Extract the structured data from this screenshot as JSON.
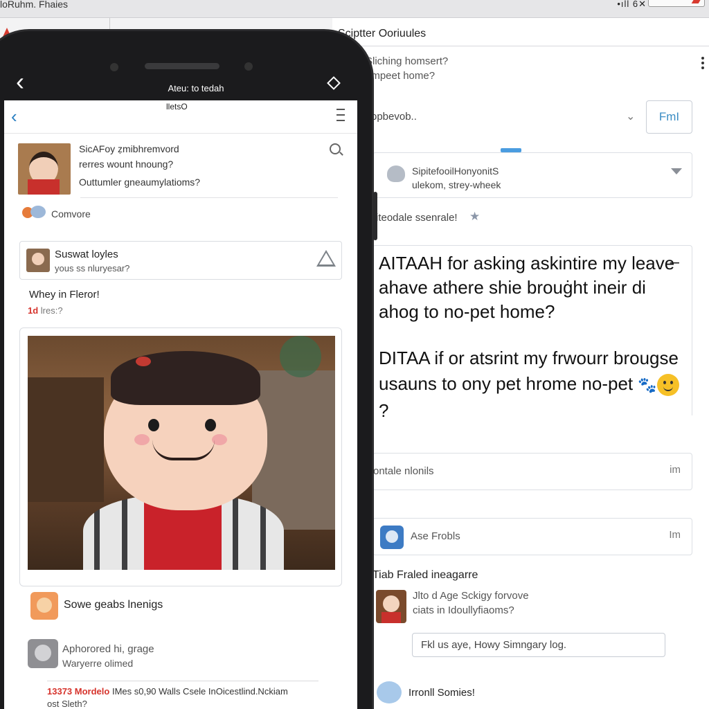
{
  "window": {
    "title": "loRuhm. Fhaies",
    "status": "•ıll 6✕"
  },
  "right_panel": {
    "header": "Sciptter Ooriuules",
    "question_line1": "Sliching homsert?",
    "question_line2": "umpeet home?",
    "filter_label": "opbevob..",
    "filter_button": "FmI",
    "card_title": "SipitefooilHonyonitS",
    "card_subtitle": "ulekom, strey-wheek",
    "suggested_label": "iteodale ssenrale!",
    "post_title": "AITAAH for asking askintire my leave ahave athere shie brouġht ineir di ahog to no-pet home?",
    "post_body_text": "DITAA if or atsrint my frwourr brougse usauns to ony pet hrome no-pet",
    "post_body_end": "?",
    "row1_label": "ontale nlonils",
    "row1_right": "im",
    "row2_label": "Ase Frobls",
    "row2_right": "Im",
    "related_heading": "Tiab Fraled ineagarre",
    "related_line1": "Jlto d Age Sckigy forvove",
    "related_line2": "ciats in Idoullyfiaoms?",
    "reply_value": "Fkl us aye, Howy Simngary log.",
    "bottom_label": "Irronll Somies!"
  },
  "phone": {
    "top_title": "Ateu: to tedah",
    "screen_header": "lletsO",
    "profile_line1": "SicAFoy ẓmibhremvord",
    "profile_line2": "rerres wount hnoung?",
    "profile_line3": "Outtumler gneaumylatioms?",
    "community_label": "Comvore",
    "card_name": "Suswat loyles",
    "card_sub": "yous ss nluryesar?",
    "post_title": "Whey in Fleror!",
    "time_prefix": "1d",
    "time_rest": "lres:?",
    "comment1": "Sowe geabs lnenigs",
    "comment2_line1": "Aphorored hi, grage",
    "comment2_line2": "Waryerre olimed",
    "footer_red": "13373 Mordelo",
    "footer_rest": "IMes s0,90 Walls Csele InOicestlind.Nckiam",
    "footer_line2": "ost Sleth?"
  },
  "colors": {
    "accent_blue": "#2a7fc1",
    "alert_red": "#d6332c",
    "button_text_blue": "#3b8dc4"
  }
}
